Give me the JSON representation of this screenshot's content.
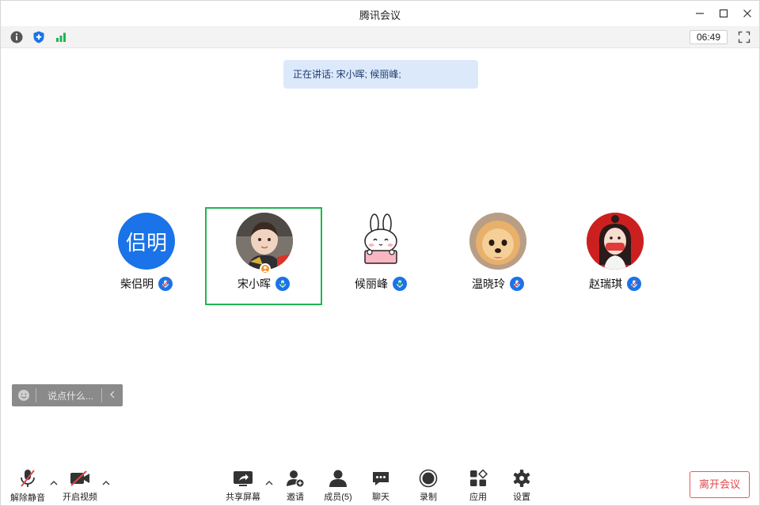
{
  "window": {
    "title": "腾讯会议"
  },
  "toolbar": {
    "timer": "06:49"
  },
  "speaking": {
    "text": "正在讲话: 宋小晖; 候丽峰;"
  },
  "participants": [
    {
      "name": "柴侣明",
      "avatar_text": "侣明"
    },
    {
      "name": "宋小晖"
    },
    {
      "name": "候丽峰"
    },
    {
      "name": "温晓玲"
    },
    {
      "name": "赵瑞琪"
    }
  ],
  "chat": {
    "placeholder": "说点什么..."
  },
  "bottom": {
    "mute": "解除静音",
    "video": "开启视频",
    "share": "共享屏幕",
    "invite": "邀请",
    "members": "成员(5)",
    "chat": "聊天",
    "record": "录制",
    "apps": "应用",
    "settings": "设置",
    "leave": "离开会议"
  },
  "colors": {
    "accent": "#1a73e8",
    "active_border": "#1fb551",
    "leave": "#e04848"
  }
}
